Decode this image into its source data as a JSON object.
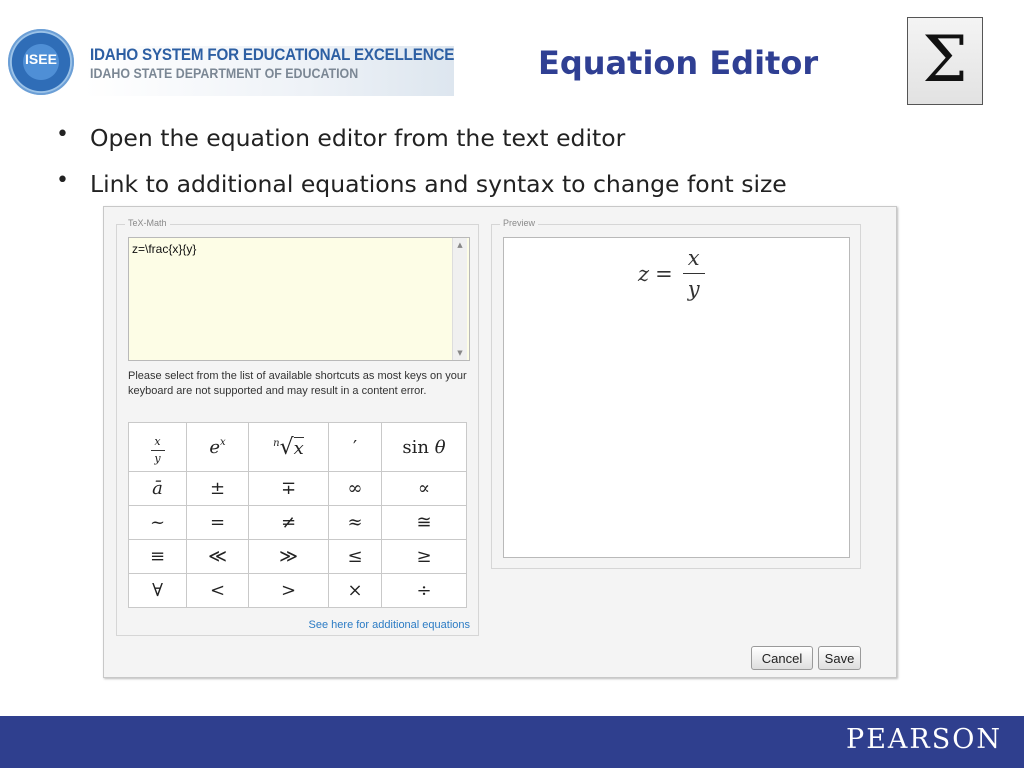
{
  "header": {
    "logo_text": "ISEE",
    "org_title": "IDAHO SYSTEM FOR EDUCATIONAL EXCELLENCE",
    "org_subtitle": "IDAHO STATE DEPARTMENT OF EDUCATION",
    "slide_title": "Equation Editor",
    "sigma_glyph": "Σ"
  },
  "bullets": [
    "Open the equation editor from the text editor",
    "Link to additional equations and syntax to change font size"
  ],
  "bullet_glyph": "•",
  "dialog": {
    "tex_group_label": "TeX-Math",
    "tex_value": "z=\\frac{x}{y}",
    "helper_text": "Please select from the list of available shortcuts as most keys on your keyboard are not supported and may result in a content error.",
    "shortcut_rows": [
      [
        "frac",
        "e^x",
        "nth-root",
        "′",
        "sin θ"
      ],
      [
        "ā",
        "±",
        "∓",
        "∞",
        "∝"
      ],
      [
        "~",
        "=",
        "≠",
        "≈",
        "≅"
      ],
      [
        "≡",
        "≪",
        "≫",
        "≤",
        "≥"
      ],
      [
        "∀",
        "<",
        ">",
        "×",
        "÷"
      ]
    ],
    "shortcut_symbols": {
      "frac_num": "x",
      "frac_den": "y",
      "exp_base": "e",
      "exp_sup": "x",
      "root_index": "n",
      "root_sign": "√",
      "root_arg": "x",
      "sin_fn": "sin",
      "sin_arg": "θ"
    },
    "more_link": "See here for additional equations",
    "preview_label": "Preview",
    "preview": {
      "lhs": "z",
      "eq": "=",
      "num": "x",
      "den": "y"
    },
    "cancel_label": "Cancel",
    "save_label": "Save"
  },
  "footer": {
    "brand": "PEARSON"
  },
  "colors": {
    "title": "#2f3f93",
    "footer_bg": "#2f3f8e",
    "link": "#2b7bc4",
    "tex_bg": "#fdfde6"
  }
}
